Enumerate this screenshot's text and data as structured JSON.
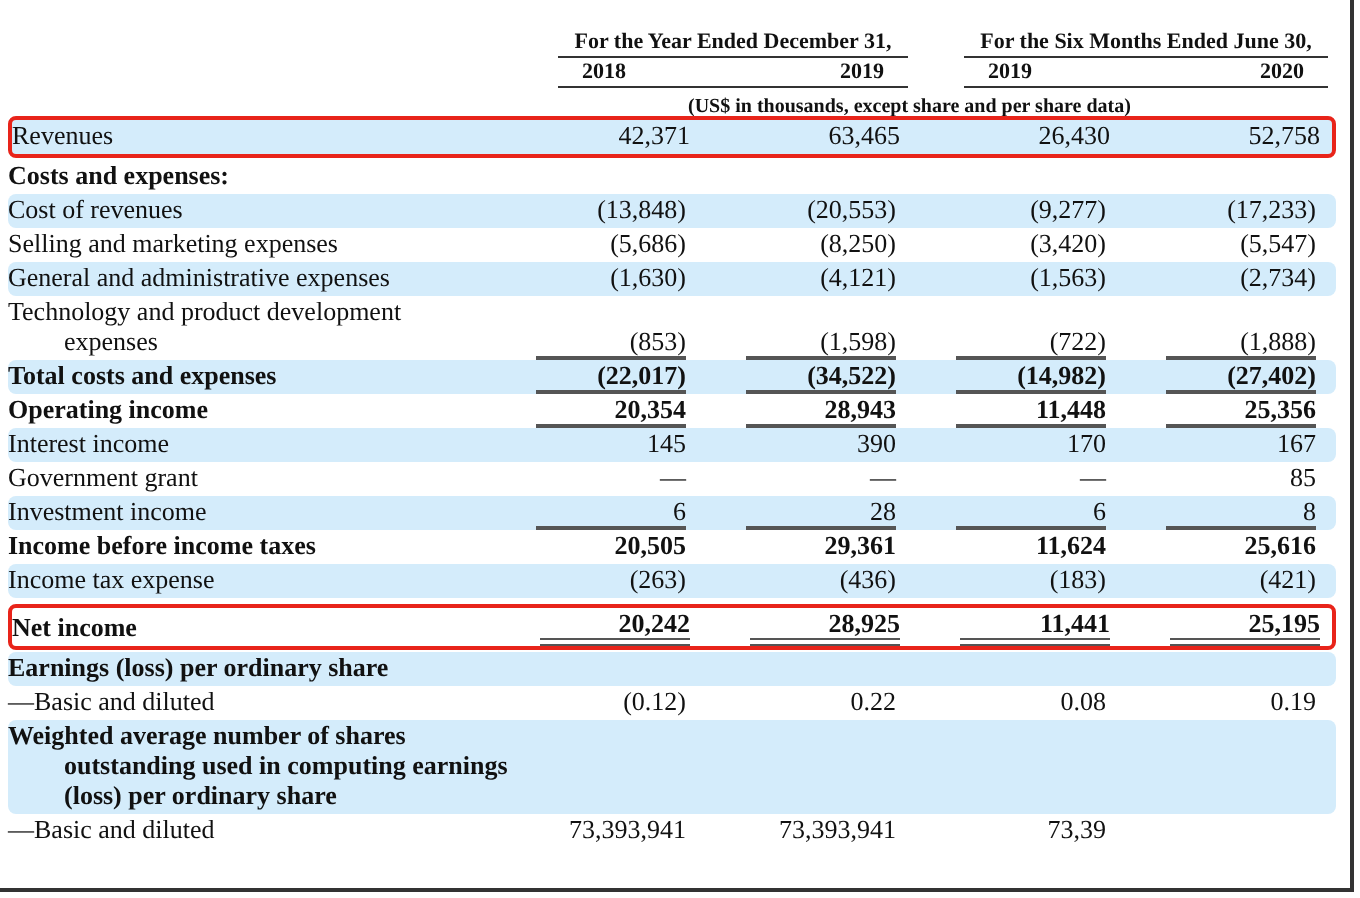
{
  "header": {
    "groups": [
      "For the Year Ended December 31,",
      "For the Six Months Ended June 30,"
    ],
    "years": [
      "2018",
      "2019",
      "2019",
      "2020"
    ],
    "units": "(US$ in thousands, except share and per share data)"
  },
  "rows": [
    {
      "label": "Revenues",
      "values": [
        "42,371",
        "63,465",
        "26,430",
        "52,758"
      ],
      "bold": false,
      "shaded": true,
      "highlighted": true,
      "underlined": false
    },
    {
      "label": "Costs and expenses:",
      "values": [],
      "bold": true,
      "shaded": false,
      "highlighted": false
    },
    {
      "label": "Cost of revenues",
      "values": [
        "(13,848)",
        "(20,553)",
        "(9,277)",
        "(17,233)"
      ],
      "bold": false,
      "shaded": true,
      "highlighted": false,
      "underlined": false
    },
    {
      "label": "Selling and marketing expenses",
      "values": [
        "(5,686)",
        "(8,250)",
        "(3,420)",
        "(5,547)"
      ],
      "bold": false,
      "shaded": false,
      "highlighted": false,
      "underlined": false
    },
    {
      "label": "General and administrative expenses",
      "values": [
        "(1,630)",
        "(4,121)",
        "(1,563)",
        "(2,734)"
      ],
      "bold": false,
      "shaded": true,
      "highlighted": false,
      "underlined": false
    },
    {
      "label": "Technology and product development",
      "continuation": "expenses",
      "values": [
        "(853)",
        "(1,598)",
        "(722)",
        "(1,888)"
      ],
      "bold": false,
      "shaded": false,
      "highlighted": false,
      "underlined": true
    },
    {
      "label": "Total costs and expenses",
      "values": [
        "(22,017)",
        "(34,522)",
        "(14,982)",
        "(27,402)"
      ],
      "bold": true,
      "shaded": true,
      "highlighted": false,
      "underlined": true
    },
    {
      "label": "Operating income",
      "values": [
        "20,354",
        "28,943",
        "11,448",
        "25,356"
      ],
      "bold": true,
      "shaded": false,
      "highlighted": false,
      "underlined": true
    },
    {
      "label": "Interest income",
      "values": [
        "145",
        "390",
        "170",
        "167"
      ],
      "bold": false,
      "shaded": true,
      "highlighted": false,
      "underlined": false
    },
    {
      "label": "Government grant",
      "values": [
        "—",
        "—",
        "—",
        "85"
      ],
      "bold": false,
      "shaded": false,
      "highlighted": false,
      "underlined": false
    },
    {
      "label": "Investment income",
      "values": [
        "6",
        "28",
        "6",
        "8"
      ],
      "bold": false,
      "shaded": true,
      "highlighted": false,
      "underlined": true
    },
    {
      "label": "Income before income taxes",
      "values": [
        "20,505",
        "29,361",
        "11,624",
        "25,616"
      ],
      "bold": true,
      "shaded": false,
      "highlighted": false,
      "underlined": false
    },
    {
      "label": "Income tax expense",
      "values": [
        "(263)",
        "(436)",
        "(183)",
        "(421)"
      ],
      "bold": false,
      "shaded": true,
      "highlighted": false,
      "underlined": false
    },
    {
      "label": "Net income",
      "values": [
        "20,242",
        "28,925",
        "11,441",
        "25,195"
      ],
      "bold": true,
      "shaded": false,
      "highlighted": true,
      "double_underline": true
    },
    {
      "label": "Earnings (loss) per ordinary share",
      "values": [],
      "bold": true,
      "shaded": true,
      "highlighted": false
    },
    {
      "label": "—Basic and diluted",
      "values": [
        "(0.12)",
        "0.22",
        "0.08",
        "0.19"
      ],
      "bold": false,
      "shaded": false,
      "highlighted": false,
      "underlined": false
    },
    {
      "label": "Weighted average number of shares",
      "continuation": "outstanding used in computing earnings",
      "continuation2": "(loss) per ordinary share",
      "values": [],
      "bold": true,
      "shaded": true,
      "highlighted": false
    },
    {
      "label": "—Basic and diluted",
      "values": [
        "73,393,941",
        "73,393,941",
        "73,39"
      ],
      "bold": false,
      "shaded": false,
      "highlighted": false,
      "underlined": false
    }
  ]
}
